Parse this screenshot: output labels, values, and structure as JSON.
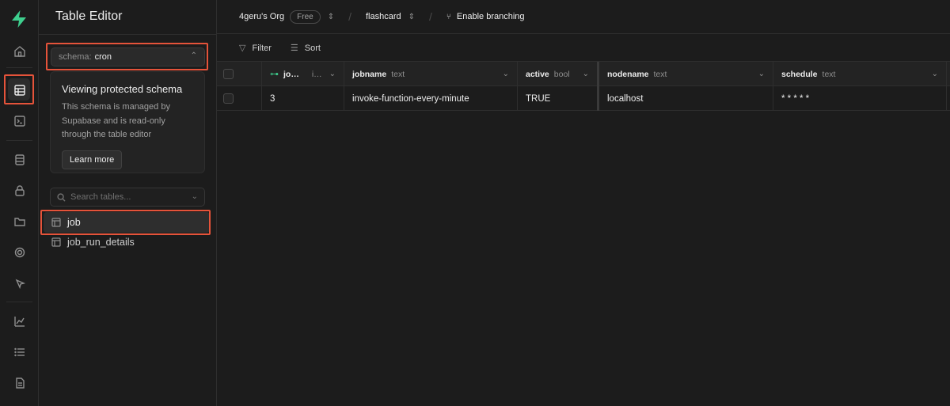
{
  "app": {
    "section_title": "Table Editor"
  },
  "topbar": {
    "org": "4geru's Org",
    "plan_badge": "Free",
    "project": "flashcard",
    "branching": "Enable branching"
  },
  "schema_selector": {
    "label": "schema:",
    "value": "cron"
  },
  "notice": {
    "title": "Viewing protected schema",
    "text": "This schema is managed by Supabase and is read-only through the table editor",
    "button": "Learn more"
  },
  "search": {
    "placeholder": "Search tables..."
  },
  "tables": [
    {
      "name": "job",
      "selected": true
    },
    {
      "name": "job_run_details",
      "selected": false
    }
  ],
  "toolbar": {
    "filter": "Filter",
    "sort": "Sort"
  },
  "grid": {
    "columns": [
      {
        "name": "jo…",
        "type": "i…"
      },
      {
        "name": "jobname",
        "type": "text"
      },
      {
        "name": "active",
        "type": "bool"
      },
      {
        "name": "nodename",
        "type": "text"
      },
      {
        "name": "schedule",
        "type": "text"
      }
    ],
    "rows": [
      {
        "jobid": "3",
        "jobname": "invoke-function-every-minute",
        "active": "TRUE",
        "nodename": "localhost",
        "schedule": "* * * * *"
      }
    ]
  },
  "colors": {
    "accent": "#3ecf8e",
    "highlight": "#e5533a",
    "background": "#1c1c1c"
  }
}
